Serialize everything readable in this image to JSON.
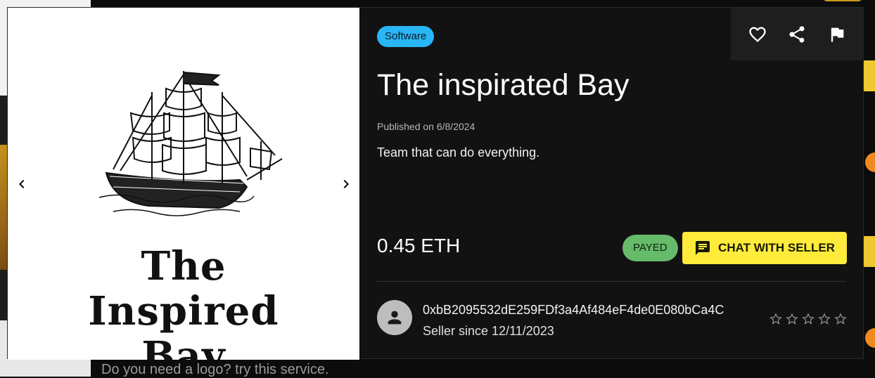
{
  "background": {
    "partial_text": "Do you need a logo? try this service."
  },
  "listing": {
    "category": "Software",
    "title": "The inspirated Bay",
    "published": "Published on 6/8/2024",
    "description": "Team that can do everything.",
    "price": "0.45 ETH",
    "status": "PAYED",
    "chat_button_label": "CHAT WITH SELLER",
    "image_logo_text": "The Inspired Bay"
  },
  "seller": {
    "address": "0xbB2095532dE259FDf3a4Af484eF4de0E080bCa4C",
    "since": "Seller since 12/11/2023",
    "rating": 0,
    "rating_max": 5
  },
  "icons": {
    "favorite": "heart-outline-icon",
    "share": "share-icon",
    "report": "flag-icon",
    "prev": "chevron-left-icon",
    "next": "chevron-right-icon",
    "chat": "chat-bubble-icon",
    "avatar": "person-icon",
    "star": "star-outline-icon"
  },
  "colors": {
    "category_chip": "#29b6f6",
    "status_chip": "#66bb6a",
    "chat_button": "#ffeb3b",
    "dialog_bg": "#121212"
  }
}
